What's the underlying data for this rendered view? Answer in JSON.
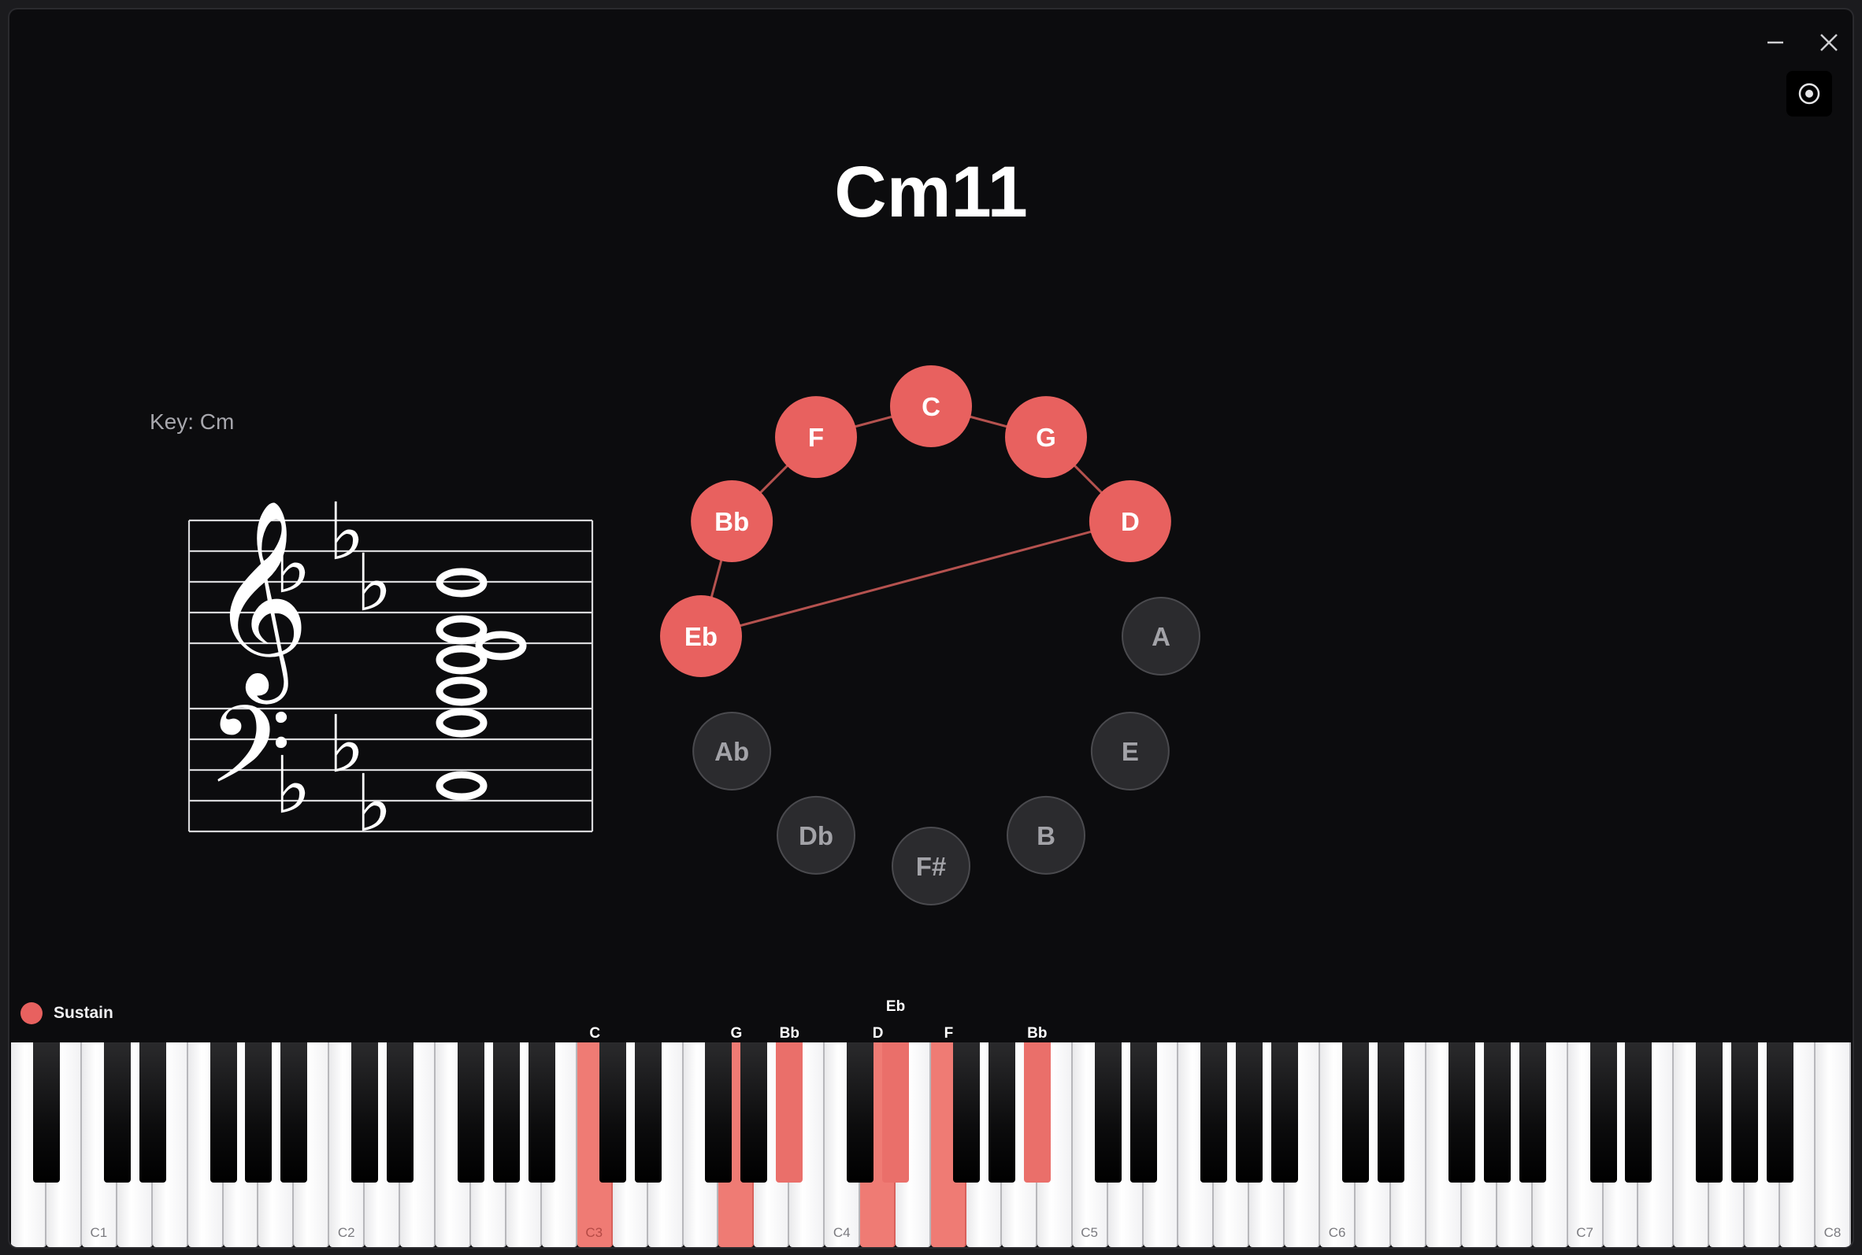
{
  "window": {
    "minimize_icon": "minus-icon",
    "close_icon": "close-icon",
    "record_icon": "record-icon"
  },
  "chord": {
    "name": "Cm11"
  },
  "key": {
    "label": "Key: Cm"
  },
  "staff": {
    "treble_clef_icon": "treble-clef-icon",
    "bass_clef_icon": "bass-clef-icon",
    "key_signature": "3 flats",
    "flat_symbol": "♭"
  },
  "circle_of_fifths": {
    "active_color": "#e8615f",
    "inactive_color": "#2b2b2e",
    "notes": [
      {
        "name": "C",
        "active": true
      },
      {
        "name": "G",
        "active": true
      },
      {
        "name": "D",
        "active": true
      },
      {
        "name": "A",
        "active": false
      },
      {
        "name": "E",
        "active": false
      },
      {
        "name": "B",
        "active": false
      },
      {
        "name": "F#",
        "active": false
      },
      {
        "name": "Db",
        "active": false
      },
      {
        "name": "Ab",
        "active": false
      },
      {
        "name": "Eb",
        "active": true
      },
      {
        "name": "Bb",
        "active": true
      },
      {
        "name": "F",
        "active": true
      }
    ]
  },
  "sustain": {
    "label": "Sustain",
    "color": "#e8615f"
  },
  "keyboard": {
    "active_color": "#ef7b74",
    "octave_labels": [
      "C1",
      "C2",
      "C3",
      "C4",
      "C5",
      "C6",
      "C7",
      "C8"
    ],
    "note_labels": [
      {
        "text": "C",
        "key": "C3"
      },
      {
        "text": "G",
        "key": "G3"
      },
      {
        "text": "Bb",
        "key": "A#3"
      },
      {
        "text": "D",
        "key": "D4"
      },
      {
        "text": "Eb",
        "key": "D#4"
      },
      {
        "text": "F",
        "key": "F4"
      },
      {
        "text": "Bb",
        "key": "A#4"
      }
    ],
    "active_keys": [
      "C3",
      "G3",
      "A#3",
      "D4",
      "D#4",
      "F4",
      "A#4"
    ]
  }
}
